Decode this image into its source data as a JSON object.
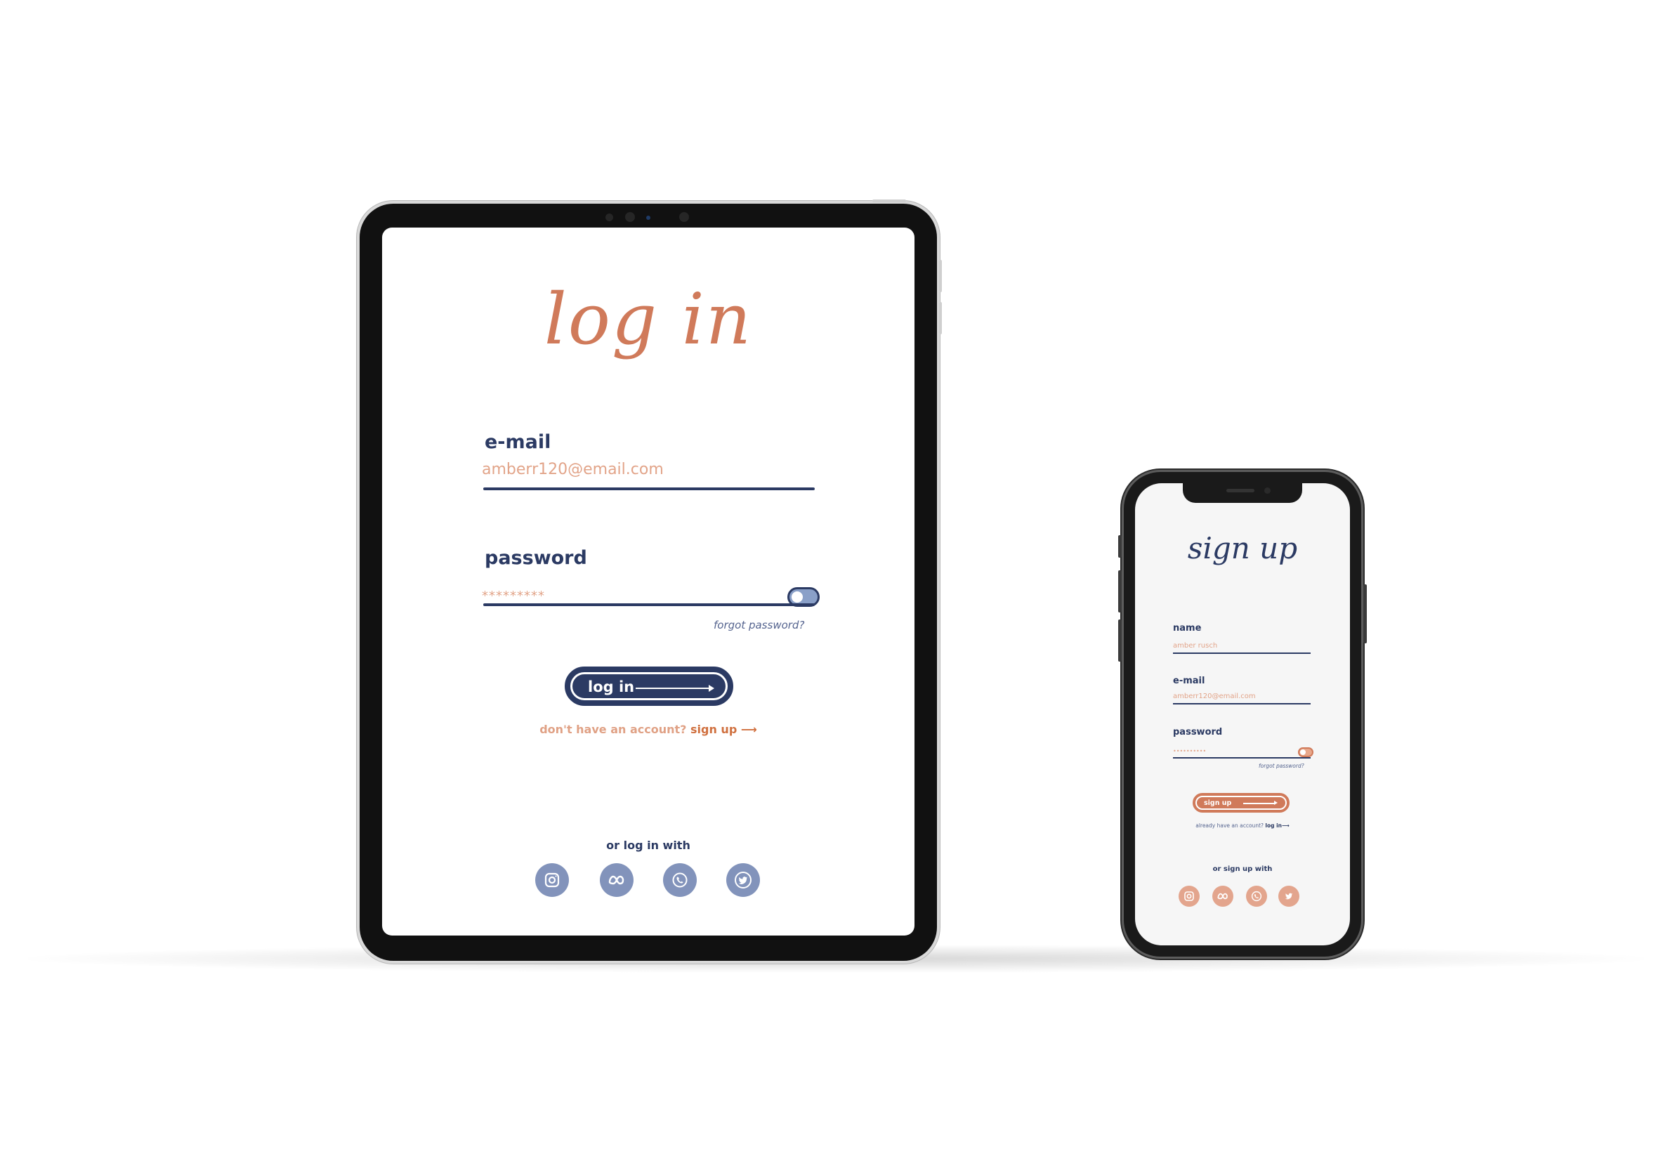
{
  "tablet": {
    "title": "log in",
    "email_label": "e-mail",
    "email_value": "amberr120@email.com",
    "password_label": "password",
    "password_value": "*********",
    "forgot_password": "forgot password?",
    "login_button": "log in",
    "no_account_text": "don't have an account?",
    "signup_link": "sign up",
    "signup_arrow": "⟶",
    "or_login_with": "or log in with",
    "social_icons": [
      "instagram-icon",
      "meta-icon",
      "whatsapp-icon",
      "twitter-icon"
    ]
  },
  "phone": {
    "title": "sign up",
    "name_label": "name",
    "name_value": "amber rusch",
    "email_label": "e-mail",
    "email_value": "amberr120@email.com",
    "password_label": "password",
    "password_value": "••••••••••",
    "forgot_password": "forgot password?",
    "signup_button": "sign up",
    "have_account_text": "already have an account?",
    "login_link": "log in⟶",
    "or_signup_with": "or sign up with",
    "social_icons": [
      "instagram-icon",
      "meta-icon",
      "whatsapp-icon",
      "twitter-icon"
    ]
  },
  "colors": {
    "navy": "#2b3a63",
    "terracotta": "#d07a5a",
    "peach": "#e2a489",
    "slate_blue": "#8293bb"
  }
}
